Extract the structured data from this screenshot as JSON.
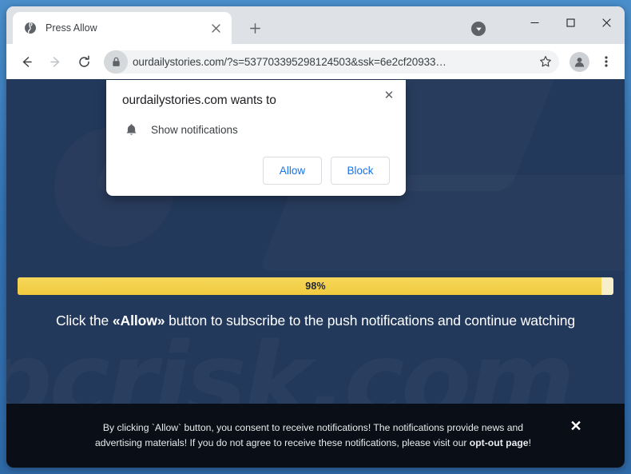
{
  "browser": {
    "tab": {
      "title": "Press Allow",
      "favicon": "globe-icon",
      "close": "×"
    },
    "new_tab_label": "+",
    "window_controls": {
      "minimize": "─",
      "maximize": "□",
      "close": "✕"
    },
    "toolbar": {
      "back": "←",
      "forward": "→",
      "reload": "↻",
      "url": "ourdailystories.com/?s=537703395298124503&ssk=6e2cf20933…",
      "lock_icon": "lock-icon",
      "bookmark_icon": "star-icon",
      "profile_icon": "profile-avatar-icon",
      "menu_icon": "three-dot-menu-icon"
    }
  },
  "permission_dialog": {
    "title": "ourdailystories.com wants to",
    "permission_label": "Show notifications",
    "permission_icon": "bell-icon",
    "close": "✕",
    "allow_label": "Allow",
    "block_label": "Block",
    "accent_color": "#1a73e8"
  },
  "page": {
    "background_color": "#23395b",
    "watermark_text": "pcrisk.com",
    "progress": {
      "percent": 98,
      "label": "98%",
      "fill_color": "#f1cb3f",
      "track_color": "#f7efc9"
    },
    "headline": {
      "before": "Click the ",
      "emphasis": "«Allow»",
      "after": " button to subscribe to the push notifications and continue watching"
    },
    "consent_banner": {
      "line1": "By clicking `Allow` button, you consent to receive notifications! The notifications provide news and",
      "line2_before": "advertising materials! If you do not agree to receive these notifications, please visit our ",
      "line2_link": "opt-out page",
      "line2_after": "!",
      "close": "✕",
      "background_color": "#0a0e16"
    }
  }
}
